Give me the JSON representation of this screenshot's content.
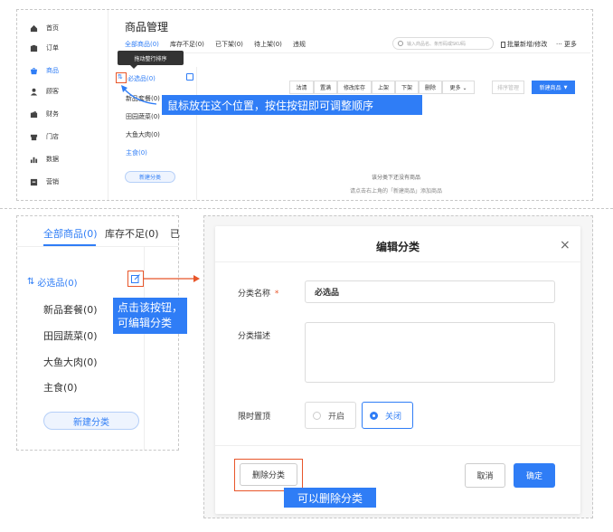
{
  "top": {
    "sidebar": [
      {
        "label": "首页",
        "icon": "home-icon"
      },
      {
        "label": "订单",
        "icon": "order-icon"
      },
      {
        "label": "商品",
        "icon": "goods-icon",
        "active": true
      },
      {
        "label": "顾客",
        "icon": "customer-icon"
      },
      {
        "label": "财务",
        "icon": "finance-icon"
      },
      {
        "label": "门店",
        "icon": "store-icon"
      },
      {
        "label": "数据",
        "icon": "data-icon"
      },
      {
        "label": "营销",
        "icon": "marketing-icon"
      }
    ],
    "page_title": "商品管理",
    "tabs": [
      "全部商品(0)",
      "库存不足(0)",
      "已下架(0)",
      "待上架(0)",
      "违规"
    ],
    "search_placeholder": "输入商品名、条形码或SKU码",
    "batch_label": "批量新增/修改",
    "more_label": "··· 更多",
    "tooltip": "拖动整行排序",
    "categories": [
      "必选品(0)",
      "新品套餐(0)",
      "田园蔬菜(0)",
      "大鱼大肉(0)",
      "主食(0)"
    ],
    "new_category": "新建分类",
    "toolbar": [
      "沽清",
      "置满",
      "修改库存",
      "上架",
      "下架",
      "删除",
      "更多 ⌄"
    ],
    "sort_manage": "排序管理",
    "new_product": "新建商品",
    "callout": "鼠标放在这个位置，按住按钮即可调整顺序",
    "empty_title": "该分类下还没有商品",
    "empty_hint": "请点击右上角的「新建商品」添加商品"
  },
  "bottom": {
    "tabs": [
      "全部商品(0)",
      "库存不足(0)",
      "已"
    ],
    "categories": [
      "必选品(0)",
      "新品套餐(0)",
      "田园蔬菜(0)",
      "大鱼大肉(0)",
      "主食(0)"
    ],
    "new_category": "新建分类",
    "callout_edit_line1": "点击该按钮，",
    "callout_edit_line2": "可编辑分类",
    "modal": {
      "title": "编辑分类",
      "close": "×",
      "name_label": "分类名称",
      "required": "*",
      "name_value": "必选品",
      "desc_label": "分类描述",
      "pin_label": "限时置顶",
      "opt_on": "开启",
      "opt_off": "关闭",
      "selected": "关闭",
      "delete": "删除分类",
      "cancel": "取消",
      "confirm": "确定"
    },
    "callout_delete": "可以删除分类"
  },
  "colors": {
    "accent": "#2f7df6",
    "highlight": "#e8562a"
  }
}
